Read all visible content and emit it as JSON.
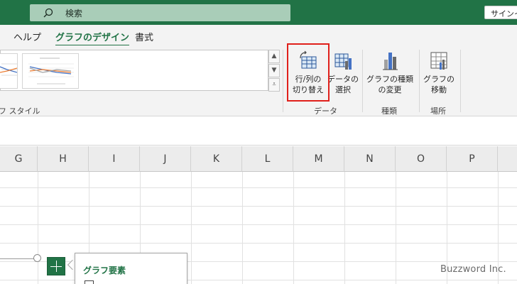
{
  "titlebar": {
    "search_text": "検索",
    "signin_label": "サインイン"
  },
  "ribbon_tabs": {
    "help": "ヘルプ",
    "chart_design": "グラフのデザイン",
    "format": "書式"
  },
  "ribbon": {
    "gallery_caption": "フ スタイル",
    "switch_row_col_line1": "行/列の",
    "switch_row_col_line2": "切り替え",
    "select_data_line1": "データの",
    "select_data_line2": "選択",
    "change_type_line1": "グラフの種類",
    "change_type_line2": "の変更",
    "move_chart_line1": "グラフの",
    "move_chart_line2": "移動",
    "group_data": "データ",
    "group_type": "種類",
    "group_location": "場所",
    "icons": {
      "scroll_up": "▲",
      "scroll_down": "▼",
      "more": "⩡"
    }
  },
  "columns": [
    "G",
    "H",
    "I",
    "J",
    "K",
    "L",
    "M",
    "N",
    "O",
    "P"
  ],
  "popup": {
    "title": "グラフ要素"
  },
  "watermark": "Buzzword Inc.",
  "colors": {
    "excel_green": "#217346",
    "highlight_red": "#e0201b"
  }
}
